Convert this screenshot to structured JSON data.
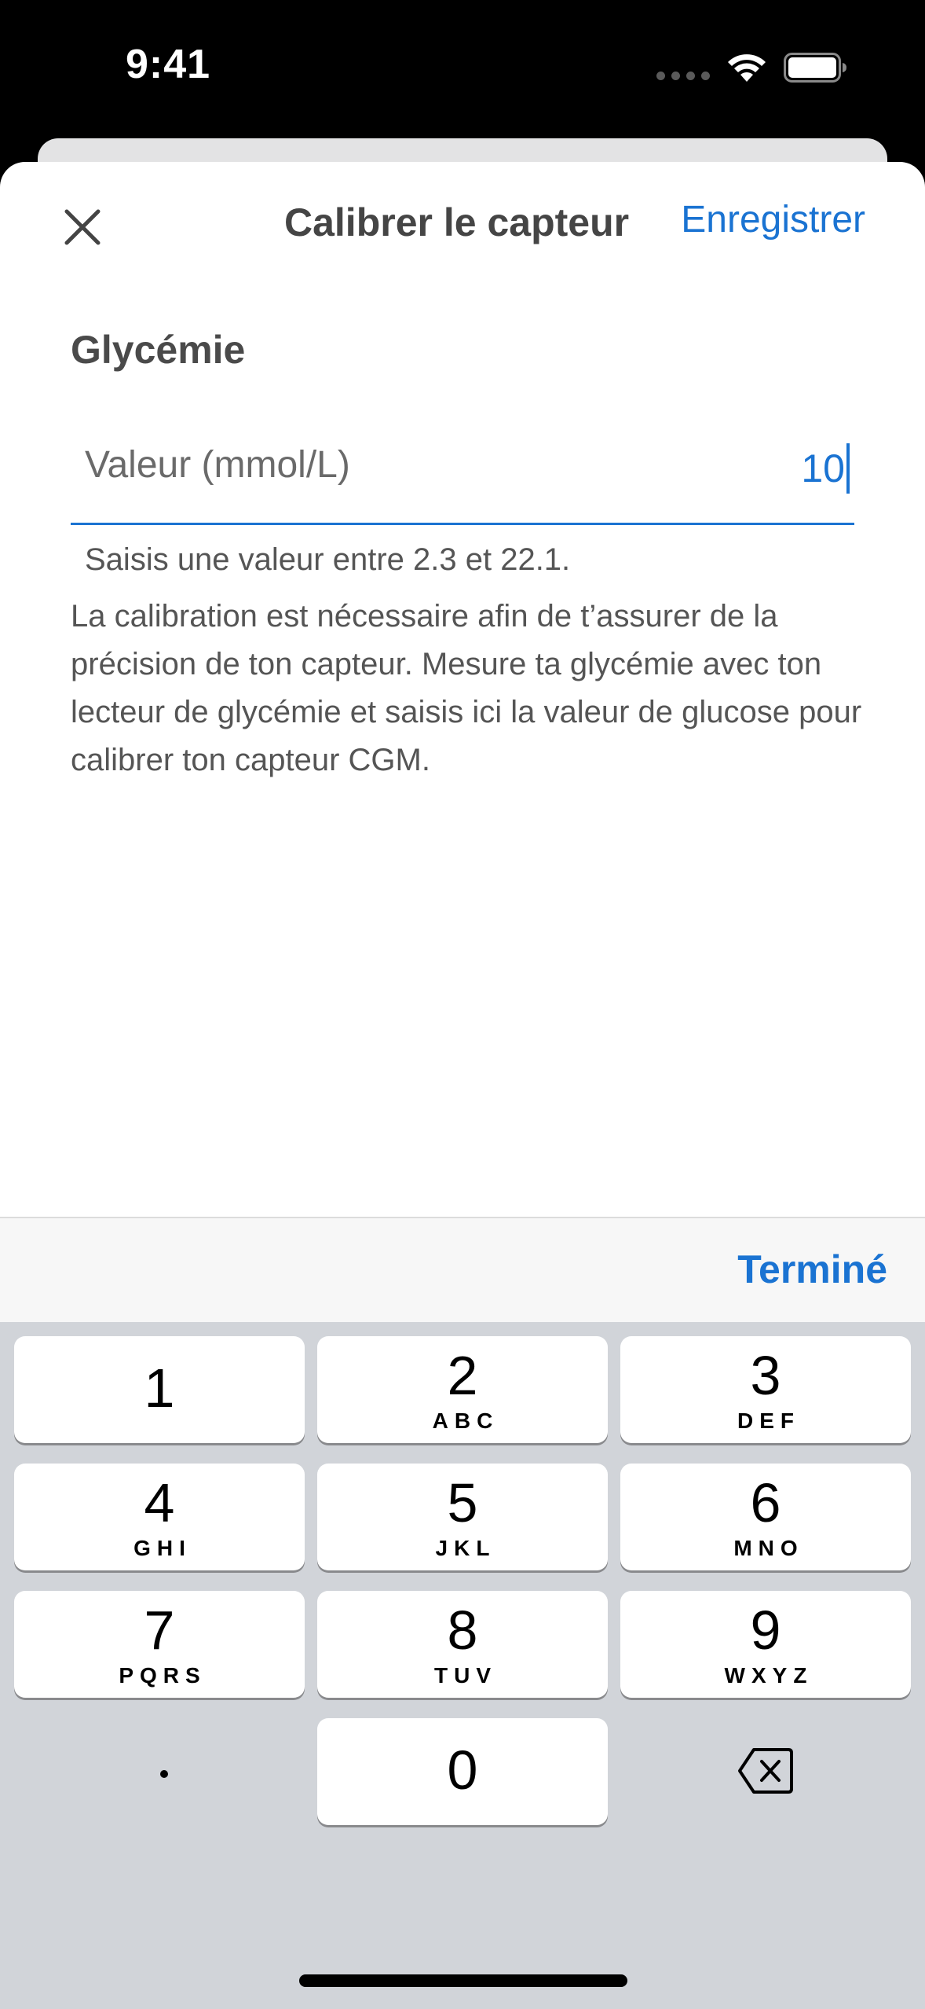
{
  "status_bar": {
    "time": "9:41",
    "icons": [
      "signal-dots-icon",
      "wifi-icon",
      "battery-icon"
    ]
  },
  "nav": {
    "close_icon": "close-icon",
    "title": "Calibrer le capteur",
    "save_label": "Enregistrer"
  },
  "form": {
    "section_label": "Glycémie",
    "field_placeholder": "Valeur (mmol/L)",
    "field_value": "10",
    "helper": "Saisis une valeur entre 2.3 et 22.1.",
    "description": "La calibration est nécessaire afin de t’assurer de la précision de ton capteur. Mesure ta glycémie avec ton lecteur de glycémie et saisis ici la valeur de glucose pour calibrer ton capteur CGM."
  },
  "accessory": {
    "done_label": "Terminé"
  },
  "keyboard": {
    "keys": [
      {
        "digit": "1",
        "letters": ""
      },
      {
        "digit": "2",
        "letters": "ABC"
      },
      {
        "digit": "3",
        "letters": "DEF"
      },
      {
        "digit": "4",
        "letters": "GHI"
      },
      {
        "digit": "5",
        "letters": "JKL"
      },
      {
        "digit": "6",
        "letters": "MNO"
      },
      {
        "digit": "7",
        "letters": "PQRS"
      },
      {
        "digit": "8",
        "letters": "TUV"
      },
      {
        "digit": "9",
        "letters": "WXYZ"
      },
      {
        "digit": "0",
        "letters": ""
      }
    ],
    "decimal_key": "decimal-point",
    "delete_icon": "backspace-icon"
  },
  "colors": {
    "accent": "#1a73d2",
    "keyboard_bg": "#d1d4d9",
    "accessory_bg": "#f7f7f7"
  }
}
